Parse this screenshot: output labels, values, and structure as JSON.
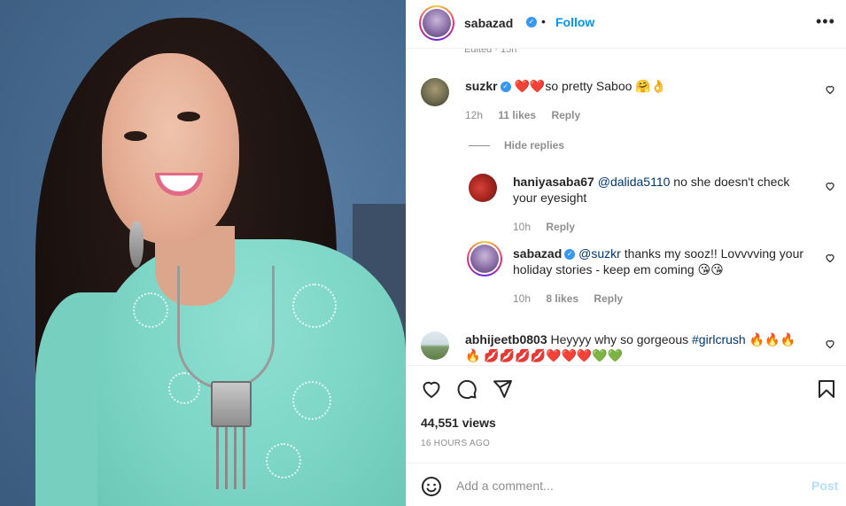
{
  "post": {
    "username": "sabazad",
    "follow_label": "Follow",
    "separator": "•",
    "more_label": "•••",
    "edited_label": "Edited · 15h"
  },
  "comments": [
    {
      "username": "suzkr",
      "verified": true,
      "text": "❤️❤️so pretty Saboo 🤗👌",
      "time": "12h",
      "likes": "11 likes",
      "reply_label": "Reply"
    }
  ],
  "hide_replies_label": "Hide replies",
  "replies": [
    {
      "username": "haniyasaba67",
      "mention": "@dalida5110",
      "text": " no she doesn't check your eyesight",
      "time": "10h",
      "reply_label": "Reply"
    },
    {
      "username": "sabazad",
      "verified": true,
      "mention": "@suzkr",
      "text": " thanks my sooz!! Lovvvving your holiday stories - keep em coming 😘😘",
      "time": "10h",
      "likes": "8 likes",
      "reply_label": "Reply"
    }
  ],
  "last_comment": {
    "username": "abhijeetb0803",
    "text": " Heyyyy why so gorgeous ",
    "hashtag": "#girlcrush",
    "tail": " 🔥🔥🔥🔥 💋💋💋💋❤️❤️❤️💚💚"
  },
  "stats": {
    "views": "44,551 views",
    "posted": "16 HOURS AGO"
  },
  "add_comment": {
    "placeholder": "Add a comment...",
    "post_label": "Post"
  },
  "icons": {
    "like": "heart-icon",
    "comment": "comment-icon",
    "share": "share-icon",
    "save": "bookmark-icon",
    "emoji": "emoji-icon"
  },
  "colors": {
    "accent": "#0095f6",
    "post_disabled": "#b2dffc",
    "verified": "#3897f0",
    "muted": "#8e8e8e"
  }
}
